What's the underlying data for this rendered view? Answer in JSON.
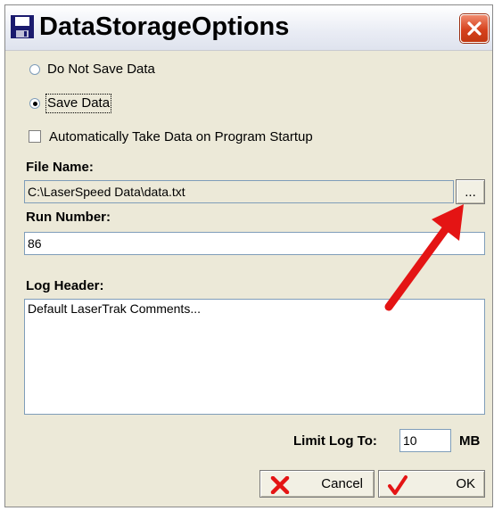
{
  "window": {
    "title": "DataStorageOptions"
  },
  "options": {
    "do_not_save": {
      "label": "Do Not Save Data",
      "selected": false
    },
    "save": {
      "label": "Save Data",
      "selected": true
    },
    "auto_take": {
      "label": "Automatically Take Data on Program Startup",
      "checked": false
    }
  },
  "file_name": {
    "label": "File Name:",
    "value": "C:\\LaserSpeed Data\\data.txt",
    "browse_label": "..."
  },
  "run_number": {
    "label": "Run Number:",
    "value": "86"
  },
  "log_header": {
    "label": "Log Header:",
    "value": "Default LaserTrak Comments..."
  },
  "limit_log": {
    "label": "Limit Log To:",
    "value": "10",
    "unit": "MB"
  },
  "buttons": {
    "cancel": "Cancel",
    "ok": "OK"
  },
  "colors": {
    "annotation_arrow": "#e41414",
    "close_button": "#d6421d"
  },
  "icons": {
    "title": "floppy-disk-icon",
    "close": "close-icon",
    "cancel": "red-x-icon",
    "ok": "red-checkmark-icon"
  }
}
